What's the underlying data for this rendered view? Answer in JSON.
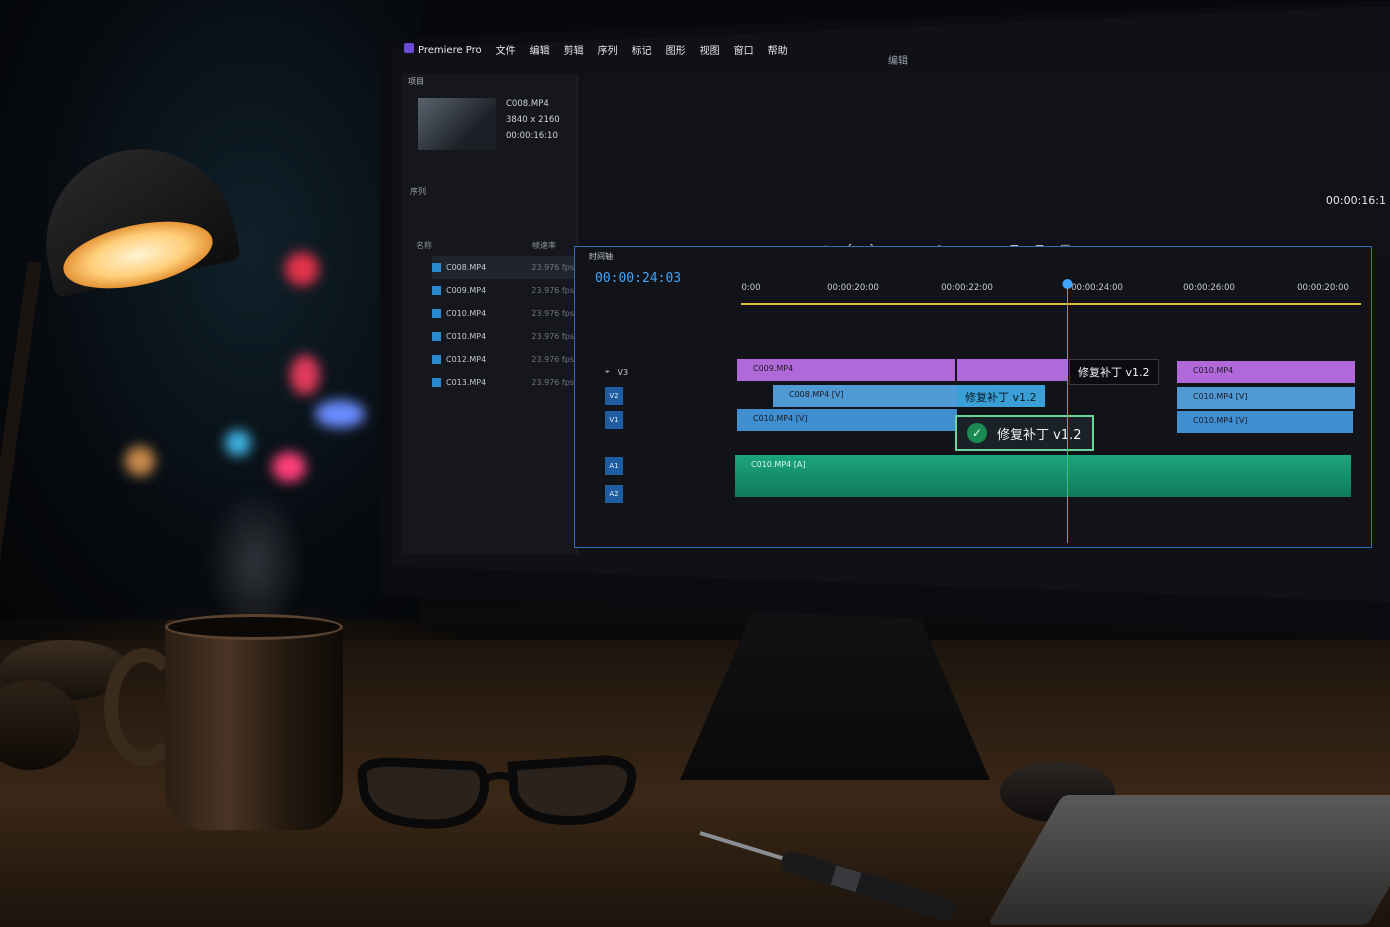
{
  "colors": {
    "accent": "#3ea6ff",
    "v3_clip": "#b168d8",
    "video_clip": "#4f9ad4",
    "audio_clip": "#1ba67c",
    "patch_border": "#6bd69a"
  },
  "app": {
    "title": "Premiere Pro",
    "menu": [
      "文件",
      "编辑",
      "剪辑",
      "序列",
      "标记",
      "图形",
      "视图",
      "窗口",
      "帮助"
    ],
    "workspace": "编辑"
  },
  "project_panel": {
    "tab_label": "项目",
    "preview": {
      "name": "C008.MP4",
      "resolution": "3840 x 2160",
      "duration": "00:00:16:10"
    },
    "bin_label": "序列",
    "columns": {
      "name": "名称",
      "rate": "帧速率"
    },
    "clips": [
      {
        "name": "C008.MP4",
        "fps": "23.976 fps",
        "selected": true
      },
      {
        "name": "C009.MP4",
        "fps": "23.976 fps",
        "selected": false
      },
      {
        "name": "C010.MP4",
        "fps": "23.976 fps",
        "selected": false
      },
      {
        "name": "C010.MP4",
        "fps": "23.976 fps",
        "selected": false
      },
      {
        "name": "C012.MP4",
        "fps": "23.976 fps",
        "selected": false
      },
      {
        "name": "C013.MP4",
        "fps": "23.976 fps",
        "selected": false
      }
    ]
  },
  "program_monitor": {
    "timecode": "00:00:16:1"
  },
  "timeline": {
    "sequence_tab": "时间轴",
    "timecode": "00:00:24:03",
    "ruler": [
      "0:00",
      "00:00:20:00",
      "00:00:22:00",
      "00:00:24:00",
      "00:00:26:00",
      "00:00:20:00"
    ],
    "tracks": [
      {
        "id": "V3",
        "label": "V3"
      },
      {
        "id": "V2",
        "label": "V2"
      },
      {
        "id": "V1",
        "label": "V1"
      },
      {
        "id": "A1",
        "label": "A1"
      },
      {
        "id": "A2",
        "label": "A2"
      }
    ],
    "clips": {
      "v3_a": "C009.MP4",
      "v3_b": "C010.MP4",
      "v2_a": "C008.MP4 [V]",
      "v2_b": "C010.MP4 [V]",
      "v1_a": "C010.MP4 [V]",
      "v1_b": "C010.MP4 [V]",
      "a1": "C010.MP4 [A]"
    },
    "patch_tooltip": "修复补丁 v1.2",
    "patch_label": "修复补丁 v1.2",
    "patch_card": "修复补丁 v1.2"
  }
}
